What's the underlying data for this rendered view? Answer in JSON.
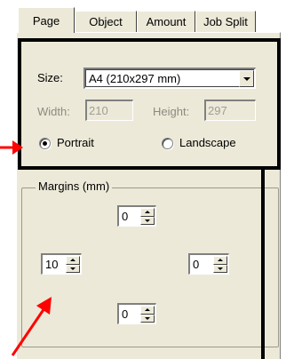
{
  "tabs": [
    {
      "label": "Page",
      "active": true
    },
    {
      "label": "Object",
      "active": false
    },
    {
      "label": "Amount",
      "active": false
    },
    {
      "label": "Job Split",
      "active": false
    }
  ],
  "size": {
    "label": "Size:",
    "value": "A4 (210x297 mm)"
  },
  "width": {
    "label": "Width:",
    "value": "210"
  },
  "height": {
    "label": "Height:",
    "value": "297"
  },
  "orientation": {
    "portrait": {
      "label": "Portrait",
      "checked": true
    },
    "landscape": {
      "label": "Landscape",
      "checked": false
    }
  },
  "margins": {
    "title": "Margins (mm)",
    "top": "0",
    "left": "10",
    "right": "0",
    "bottom": "0"
  },
  "colors": {
    "highlight": "#000000",
    "arrow": "#ff0000",
    "panel": "#ece9d8"
  }
}
